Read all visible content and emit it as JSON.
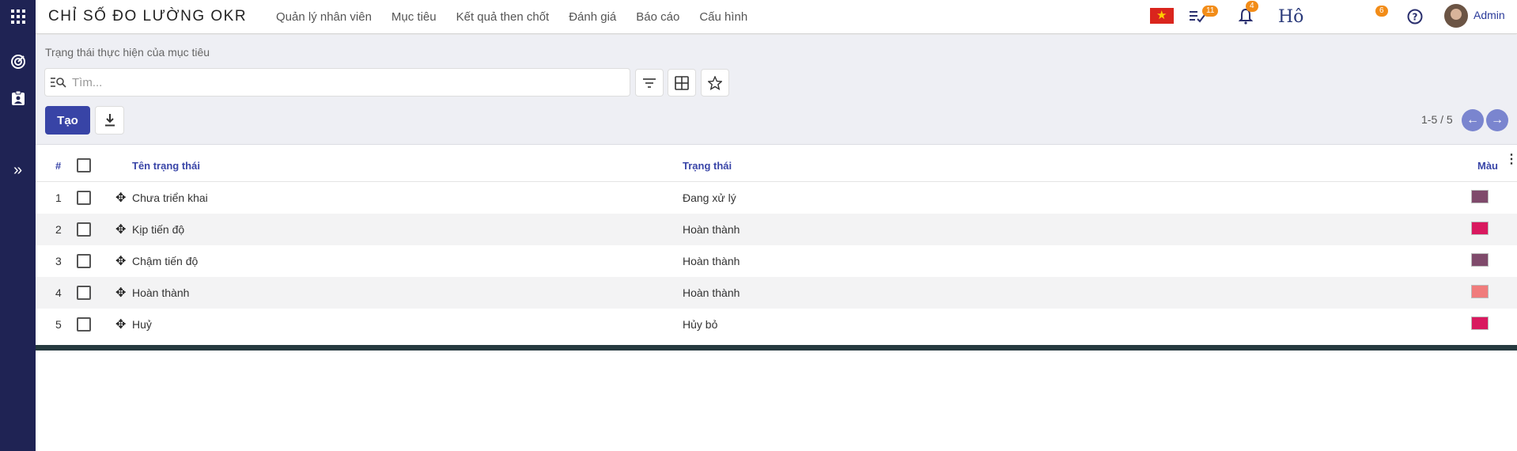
{
  "app": {
    "title": "CHỈ SỐ ĐO LƯỜNG OKR"
  },
  "nav": {
    "items": [
      "Quản lý nhân viên",
      "Mục tiêu",
      "Kết quả then chốt",
      "Đánh giá",
      "Báo cáo",
      "Cấu hình"
    ]
  },
  "topbar": {
    "language_flag": "vn-flag",
    "activities_badge": "11",
    "notifications_badge": "4",
    "ho_text": "Hô",
    "extra_badge": "6",
    "user_name": "Admin"
  },
  "sidebar": {
    "icons": [
      "apps-grid-icon",
      "target-icon",
      "clipboard-user-icon",
      "expand-chevrons-icon"
    ]
  },
  "control_panel": {
    "breadcrumb": "Trạng thái thực hiện của mục tiêu",
    "search_placeholder": "Tìm...",
    "create_label": "Tạo",
    "pager": "1-5 / 5"
  },
  "table": {
    "columns": {
      "index": "#",
      "name": "Tên trạng thái",
      "status": "Trạng thái",
      "color": "Màu"
    },
    "rows": [
      {
        "index": "1",
        "name": "Chưa triển khai",
        "status": "Đang xử lý",
        "color": "#7f4a6b"
      },
      {
        "index": "2",
        "name": "Kịp tiến độ",
        "status": "Hoàn thành",
        "color": "#d9195f"
      },
      {
        "index": "3",
        "name": "Chậm tiến độ",
        "status": "Hoàn thành",
        "color": "#7f4a6b"
      },
      {
        "index": "4",
        "name": "Hoàn thành",
        "status": "Hoàn thành",
        "color": "#f07c7c"
      },
      {
        "index": "5",
        "name": "Huỷ",
        "status": "Hủy bỏ",
        "color": "#d9195f"
      }
    ]
  },
  "colors": {
    "sidebar_bg": "#1f2354",
    "primary": "#3844a6",
    "badge": "#f28c18",
    "header_text": "#3a46a8"
  }
}
